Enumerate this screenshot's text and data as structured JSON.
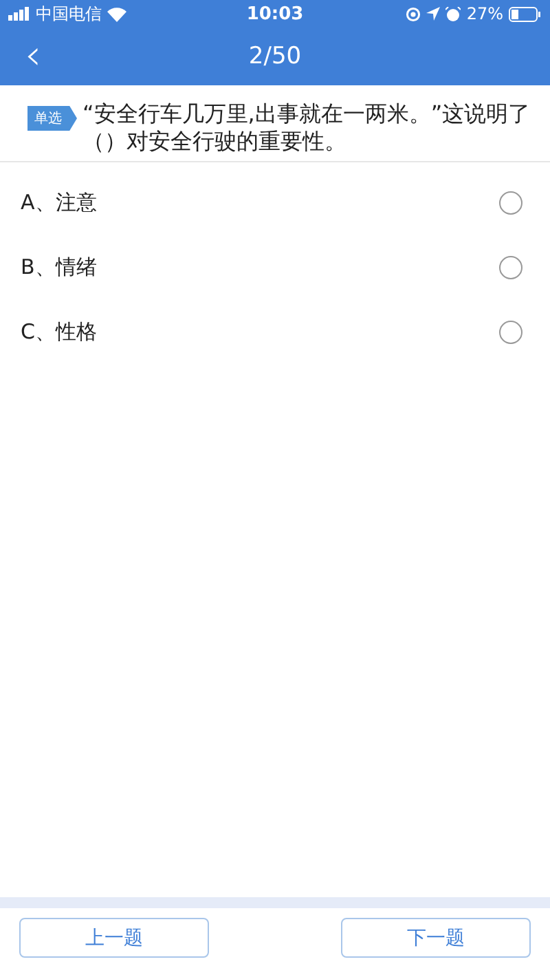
{
  "status_bar": {
    "carrier": "中国电信",
    "time": "10:03",
    "battery": "27%"
  },
  "header": {
    "back": "‹",
    "title": "2/50"
  },
  "question": {
    "tag": "单选",
    "text": "“安全行车几万里,出事就在一两米。”这说明了（）对安全行驶的重要性。"
  },
  "options": [
    {
      "label": "A、注意",
      "selected": false
    },
    {
      "label": "B、情绪",
      "selected": false
    },
    {
      "label": "C、性格",
      "selected": false
    }
  ],
  "buttons": [
    {
      "label": "上一题"
    },
    {
      "label": "下一题"
    }
  ]
}
